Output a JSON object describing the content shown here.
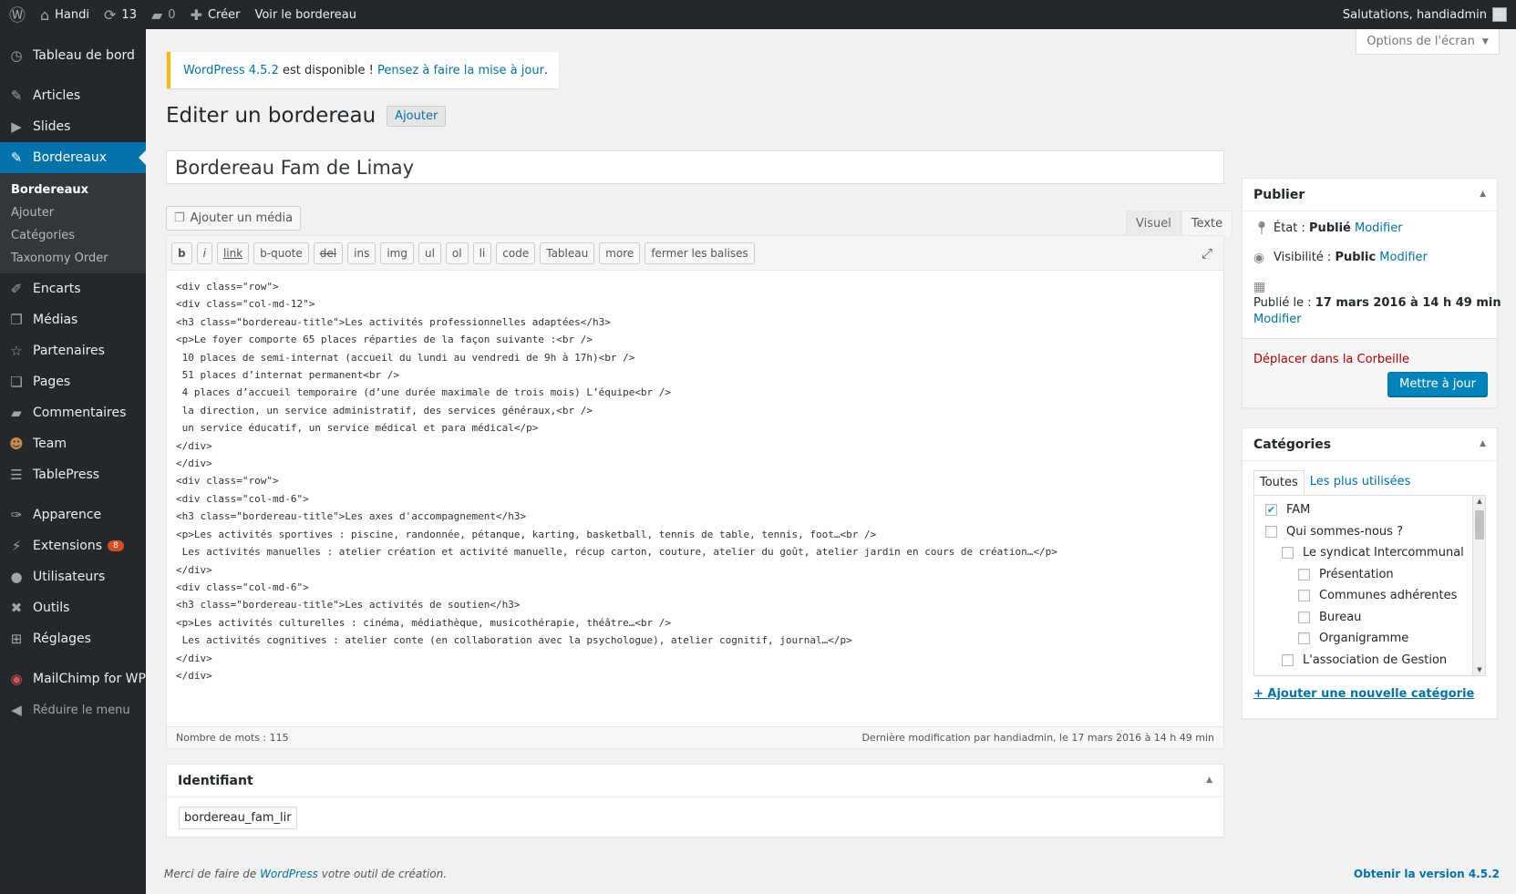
{
  "adminbar": {
    "site_name": "Handi",
    "updates_count": "13",
    "comments_count": "0",
    "create_label": "Créer",
    "view_label": "Voir le bordereau",
    "greeting": "Salutations, handiadmin"
  },
  "sidebar": {
    "dashboard": "Tableau de bord",
    "articles": "Articles",
    "slides": "Slides",
    "bordereaux": "Bordereaux",
    "submenu": [
      "Bordereaux",
      "Ajouter",
      "Catégories",
      "Taxonomy Order"
    ],
    "encarts": "Encarts",
    "medias": "Médias",
    "partenaires": "Partenaires",
    "pages": "Pages",
    "commentaires": "Commentaires",
    "team": "Team",
    "tablepress": "TablePress",
    "apparence": "Apparence",
    "extensions": "Extensions",
    "extensions_badge": "8",
    "utilisateurs": "Utilisateurs",
    "outils": "Outils",
    "reglages": "Réglages",
    "mailchimp": "MailChimp for WP",
    "collapse": "Réduire le menu"
  },
  "screen_options": "Options de l'écran",
  "notice": {
    "link1": "WordPress 4.5.2",
    "middle": " est disponible ! ",
    "link2": "Pensez à faire la mise à jour",
    "end": "."
  },
  "page": {
    "title": "Editer un bordereau",
    "add_button": "Ajouter",
    "post_title": "Bordereau Fam de Limay"
  },
  "editor": {
    "add_media": "Ajouter un média",
    "tab_visual": "Visuel",
    "tab_text": "Texte",
    "quicktags": [
      "b",
      "i",
      "link",
      "b-quote",
      "del",
      "ins",
      "img",
      "ul",
      "ol",
      "li",
      "code",
      "Tableau",
      "more",
      "fermer les balises"
    ],
    "content": "<div class=\"row\">\n<div class=\"col-md-12\">\n<h3 class=\"bordereau-title\">Les activités professionnelles adaptées</h3>\n<p>Le foyer comporte 65 places réparties de la façon suivante :<br />\n 10 places de semi-internat (accueil du lundi au vendredi de 9h à 17h)<br />\n 51 places d’internat permanent<br />\n 4 places d’accueil temporaire (d’une durée maximale de trois mois) L’équipe<br />\n la direction, un service administratif, des services généraux,<br />\n un service éducatif, un service médical et para médical</p>\n</div>\n</div>\n<div class=\"row\">\n<div class=\"col-md-6\">\n<h3 class=\"bordereau-title\">Les axes d'accompagnement</h3>\n<p>Les activités sportives : piscine, randonnée, pétanque, karting, basketball, tennis de table, tennis, foot…<br />\n Les activités manuelles : atelier création et activité manuelle, récup carton, couture, atelier du goût, atelier jardin en cours de création…</p>\n</div>\n<div class=\"col-md-6\">\n<h3 class=\"bordereau-title\">Les activités de soutien</h3>\n<p>Les activités culturelles : cinéma, médiathèque, musicothérapie, théâtre…<br />\n Les activités cognitives : atelier conte (en collaboration avec la psychologue), atelier cognitif, journal…</p>\n</div>\n</div>",
    "word_count": "Nombre de mots : 115",
    "last_modified": "Dernière modification par handiadmin, le 17 mars 2016 à 14 h 49 min"
  },
  "identifiant": {
    "title": "Identifiant",
    "value": "bordereau_fam_lir"
  },
  "publish": {
    "title": "Publier",
    "status_label": "État : ",
    "status_value": "Publié",
    "visibility_label": "Visibilité : ",
    "visibility_value": "Public",
    "published_label": "Publié le : ",
    "published_value": "17 mars 2016 à 14 h 49 min",
    "modify": "Modifier",
    "trash": "Déplacer dans la Corbeille",
    "update_button": "Mettre à jour"
  },
  "categories": {
    "title": "Catégories",
    "tab_all": "Toutes",
    "tab_popular": "Les plus utilisées",
    "items": [
      {
        "label": "FAM",
        "checked": true,
        "level": 0
      },
      {
        "label": "Qui sommes-nous ?",
        "checked": false,
        "level": 0
      },
      {
        "label": "Le syndicat Intercommunal",
        "checked": false,
        "level": 1
      },
      {
        "label": "Présentation",
        "checked": false,
        "level": 2
      },
      {
        "label": "Communes adhérentes",
        "checked": false,
        "level": 2
      },
      {
        "label": "Bureau",
        "checked": false,
        "level": 2
      },
      {
        "label": "Organigramme",
        "checked": false,
        "level": 2
      },
      {
        "label": "L'association de Gestion",
        "checked": false,
        "level": 1
      }
    ],
    "add_new": "+ Ajouter une nouvelle catégorie"
  },
  "footer": {
    "text_before": "Merci de faire de ",
    "link": "WordPress",
    "text_after": " votre outil de création.",
    "version": "Obtenir la version 4.5.2"
  },
  "colors": {
    "admin_bg": "#23282d",
    "accent": "#0073aa",
    "primary_button": "#0085ba"
  }
}
